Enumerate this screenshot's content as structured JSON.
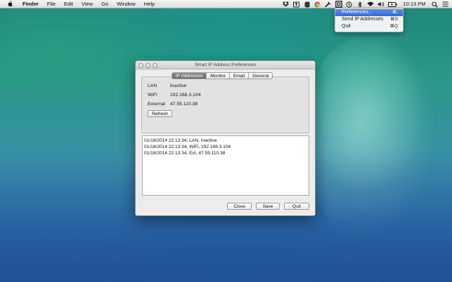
{
  "menubar": {
    "app_name": "Finder",
    "items": [
      "File",
      "Edit",
      "View",
      "Go",
      "Window",
      "Help"
    ],
    "clock": "10:13 PM",
    "status_icons": [
      "dropbox-icon",
      "upload-icon",
      "evernote-icon",
      "chrome-icon",
      "wrench-icon",
      "smart-ip-icon",
      "time-machine-icon",
      "bluetooth-icon",
      "wifi-icon",
      "volume-icon",
      "battery-icon",
      "spotlight-icon",
      "list-icon"
    ]
  },
  "dropdown": {
    "items": [
      {
        "label": "Preferences...",
        "shortcut": "⌘,"
      },
      {
        "label": "Send IP Addresses",
        "shortcut": "⌘S"
      },
      {
        "label": "Quit",
        "shortcut": "⌘Q"
      }
    ]
  },
  "window": {
    "title": "Smart IP Address Preferences",
    "tabs": [
      "IP Addresses",
      "Monitor",
      "Email",
      "General"
    ],
    "selected_tab": "IP Addresses",
    "ip_rows": [
      {
        "label": "LAN",
        "value": "Inactive"
      },
      {
        "label": "WiFi",
        "value": "192.168.3.104"
      },
      {
        "label": "External",
        "value": "47.55.110.38"
      }
    ],
    "refresh_label": "Refresh",
    "log_lines": [
      "01/18/2014 22:13:34, LAN, Inactive",
      "01/18/2014 22:13:34, WiFi, 192.168.3.104",
      "01/18/2014 22:13:34, Ext, 47.55.110.38"
    ],
    "buttons": {
      "close": "Close",
      "save": "Save",
      "quit": "Quit"
    }
  },
  "colors": {
    "menu_highlight": "#2f69d6",
    "selected_tab": "#7a7a7a"
  }
}
